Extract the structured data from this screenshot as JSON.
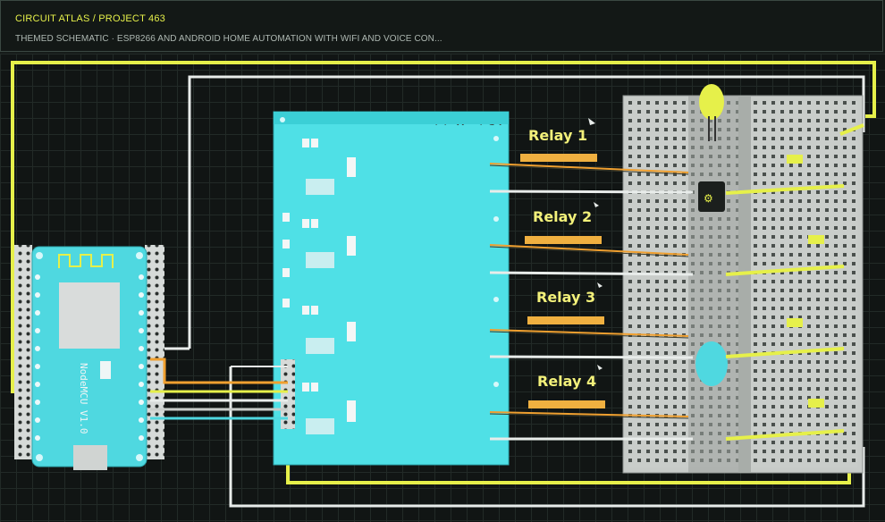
{
  "header": {
    "breadcrumb": "CIRCUIT ATLAS / PROJECT 463",
    "subtitle": "THEMED SCHEMATIC · ESP8266 AND ANDROID HOME AUTOMATION WITH WIFI AND VOICE CON..."
  },
  "diagram": {
    "module_label": "4 Relay Module",
    "mcu_label": "NodeMCU V1.0",
    "relays": [
      "Relay 1",
      "Relay 2",
      "Relay 3",
      "Relay 4"
    ]
  },
  "colors": {
    "background": "#161b19",
    "accent_yellow": "#e6f04a",
    "module_cyan": "#4fe0e6",
    "wire_white": "#e8ecea",
    "wire_orange": "#f0a030",
    "breadboard": "#c8ccc9"
  }
}
